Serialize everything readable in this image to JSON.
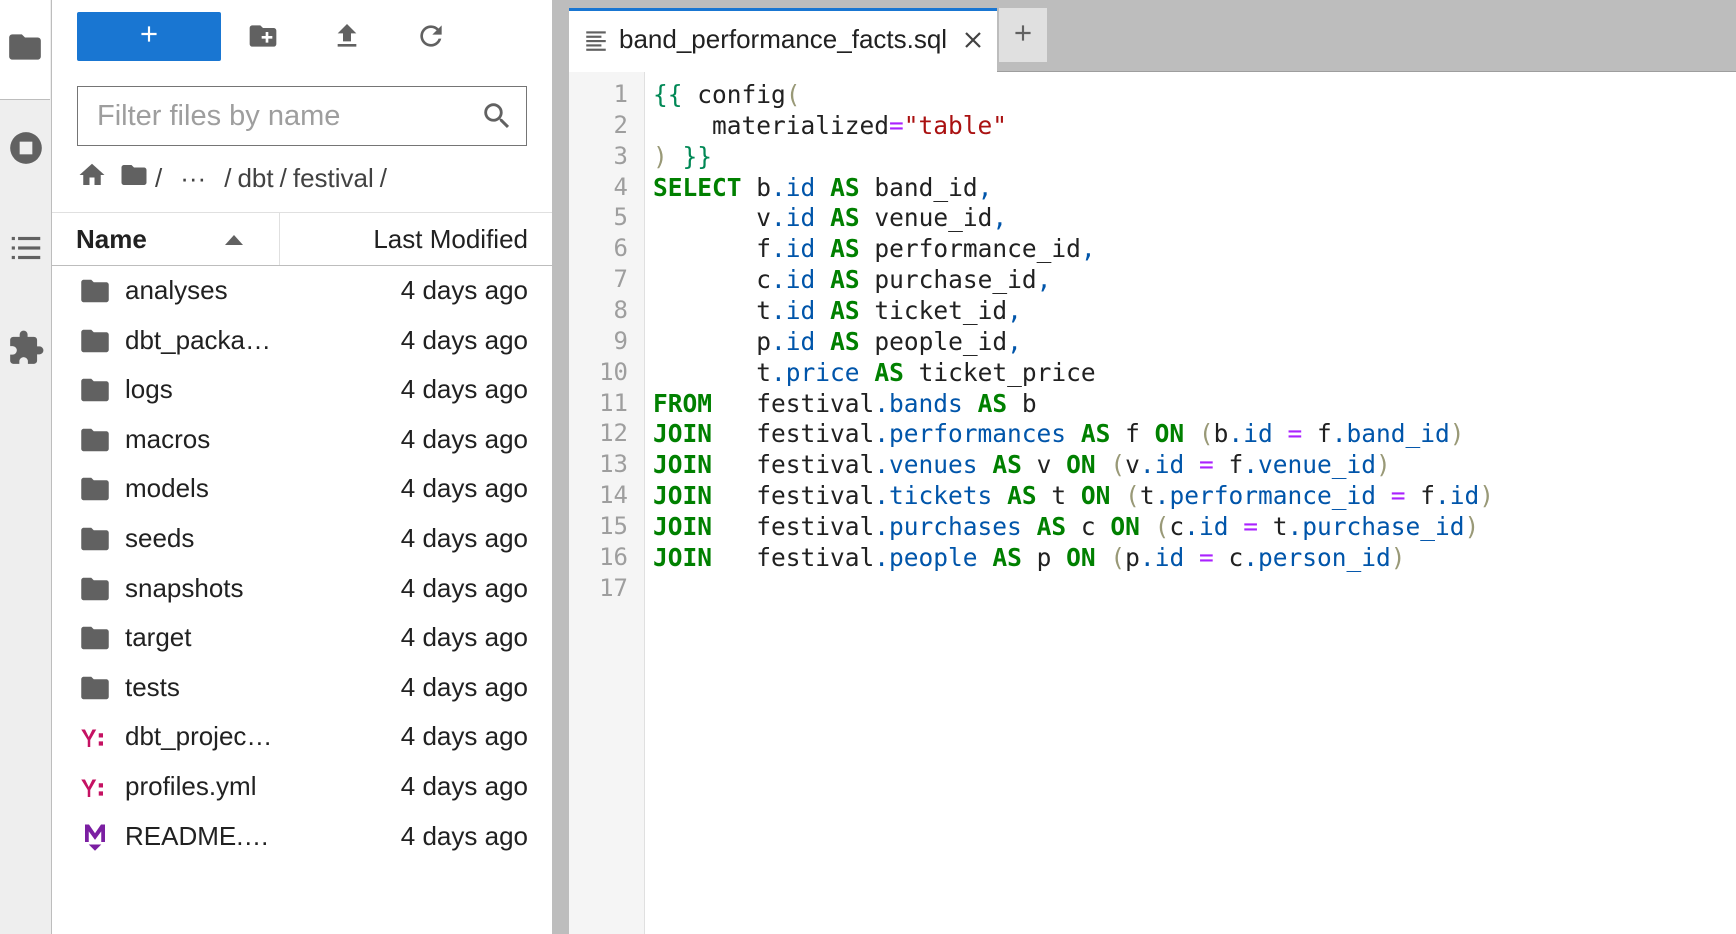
{
  "sidebar": {
    "items": [
      {
        "icon": "folder-icon",
        "label": "File Browser",
        "active": true
      },
      {
        "icon": "stop-circle-icon",
        "label": "Running Terminals and Kernels"
      },
      {
        "icon": "list-icon",
        "label": "Table of Contents"
      },
      {
        "icon": "puzzle-icon",
        "label": "Extension Manager"
      }
    ]
  },
  "file_browser": {
    "new_button_label": "+",
    "toolbar_icons": [
      "new-folder-icon",
      "upload-icon",
      "refresh-icon"
    ],
    "filter": {
      "placeholder": "Filter files by name",
      "value": ""
    },
    "breadcrumbs": {
      "sep1": "/",
      "ellipsis": "···",
      "sep2": "/",
      "dir1": "dbt",
      "sep3": "/",
      "dir2": "festival",
      "sep4": "/"
    },
    "columns": {
      "name": "Name",
      "modified": "Last Modified"
    },
    "files": [
      {
        "name": "analyses",
        "modified": "4 days ago",
        "type": "folder"
      },
      {
        "name": "dbt_packa…",
        "modified": "4 days ago",
        "type": "folder"
      },
      {
        "name": "logs",
        "modified": "4 days ago",
        "type": "folder"
      },
      {
        "name": "macros",
        "modified": "4 days ago",
        "type": "folder"
      },
      {
        "name": "models",
        "modified": "4 days ago",
        "type": "folder"
      },
      {
        "name": "seeds",
        "modified": "4 days ago",
        "type": "folder"
      },
      {
        "name": "snapshots",
        "modified": "4 days ago",
        "type": "folder"
      },
      {
        "name": "target",
        "modified": "4 days ago",
        "type": "folder"
      },
      {
        "name": "tests",
        "modified": "4 days ago",
        "type": "folder"
      },
      {
        "name": "dbt_projec…",
        "modified": "4 days ago",
        "type": "yaml"
      },
      {
        "name": "profiles.yml",
        "modified": "4 days ago",
        "type": "yaml"
      },
      {
        "name": "README.…",
        "modified": "4 days ago",
        "type": "markdown"
      }
    ]
  },
  "editor": {
    "tab_label": "band_performance_facts.sql",
    "add_tab_label": "+",
    "line_numbers": [
      "1",
      "2",
      "3",
      "4",
      "5",
      "6",
      "7",
      "8",
      "9",
      "10",
      "11",
      "12",
      "13",
      "14",
      "15",
      "16",
      "17"
    ],
    "code_lines": [
      "{{ config(",
      "    materialized=\"table\"",
      ") }}",
      "SELECT b.id AS band_id,",
      "       v.id AS venue_id,",
      "       f.id AS performance_id,",
      "       c.id AS purchase_id,",
      "       t.id AS ticket_id,",
      "       p.id AS people_id,",
      "       t.price AS ticket_price",
      "FROM   festival.bands AS b",
      "JOIN   festival.performances AS f ON (b.id = f.band_id)",
      "JOIN   festival.venues AS v ON (v.id = f.venue_id)",
      "JOIN   festival.tickets AS t ON (t.performance_id = f.id)",
      "JOIN   festival.purchases AS c ON (c.id = t.purchase_id)",
      "JOIN   festival.people AS p ON (p.id = c.person_id)",
      ""
    ]
  },
  "colors": {
    "accent": "#1976d2",
    "keyword": "#008000",
    "attribute": "#0055aa",
    "string": "#aa1111",
    "operator": "#aa22ff",
    "yaml_icon": "#c51162",
    "markdown_icon": "#7b1fa2"
  }
}
